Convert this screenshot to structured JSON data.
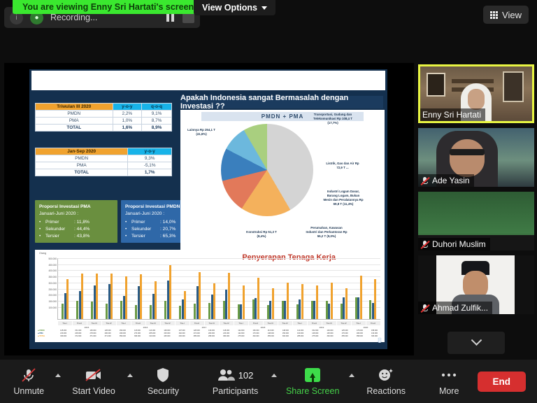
{
  "top": {
    "recording_label": "Recording...",
    "view_banner": "You are viewing Enny Sri Hartati's screen",
    "view_options": "View Options",
    "view_button": "View"
  },
  "slide": {
    "page_number": "8",
    "headline": "Apakah Indonesia sangat Bermasalah dengan Investasi ??",
    "table_q3": {
      "title": "Triwulan III 2020",
      "columns": [
        "y-o-y",
        "q-o-q"
      ],
      "rows": [
        {
          "label": "PMDN",
          "yoy": "2,2%",
          "qoq": "9,1%"
        },
        {
          "label": "PMA",
          "yoy": "1,0%",
          "qoq": "8,7%"
        },
        {
          "label": "TOTAL",
          "yoy": "1,6%",
          "qoq": "8,9%"
        }
      ]
    },
    "table_jansep": {
      "title": "Jan-Sep 2020",
      "columns": [
        "y-o-y"
      ],
      "rows": [
        {
          "label": "PMDN",
          "yoy": "9,3%"
        },
        {
          "label": "PMA",
          "yoy": "-5,1%"
        },
        {
          "label": "TOTAL",
          "yoy": "1,7%"
        }
      ]
    },
    "box_pma": {
      "title": "Proporsi Investasi PMA",
      "subtitle": "Januari-Juni 2020 :",
      "items": [
        {
          "name": "Primer",
          "value": ": 11,8%"
        },
        {
          "name": "Sekunder",
          "value": ": 44,4%"
        },
        {
          "name": "Tersier",
          "value": ": 43,8%"
        }
      ]
    },
    "box_pmdn": {
      "title": "Proporsi Investasi PMDN",
      "subtitle": "Januari-Juni 2020 :",
      "items": [
        {
          "name": "Primer",
          "value": ": 14,0%"
        },
        {
          "name": "Sekunder",
          "value": ": 20,7%"
        },
        {
          "name": "Tersier",
          "value": ": 65,3%"
        }
      ]
    }
  },
  "chart_data": [
    {
      "type": "pie",
      "title": "PMDN + PMA",
      "unit": "Rp Triliun",
      "labels": [
        "Lainnya",
        "Transportasi, Gudang dan Telekomunikasi",
        "Listrik, Gas dan Air",
        "Industri Logam Dasar, Barang Logam, Bukan Mesin dan Peralatannya",
        "Perumahan, Kawasan Industri dan Perkantoran",
        "Konstruksi"
      ],
      "values": [
        254.1,
        108.4,
        72.9,
        69.8,
        55.2,
        51.3
      ],
      "percents": [
        41.6,
        17.7,
        11.9,
        11.4,
        9.0,
        8.4
      ],
      "value_labels": [
        "Lainnya\nRp 254,1 T\n(41,6%)",
        "Transportasi,\nGudang dan\nTelekomunikasi\nRp 108,4 T\n(17,7%)",
        "Listrik, Gas\ndan Air\nRp 72,9 T ...",
        "Industri Logam\nDasar, Barang\nLogam, Bukan\nMesin dan\nPeralatannya\nRp 69,8 T\n(11,4%)",
        "Perumahan,\nKawasan Industri\ndan Perkantoran\nRp 55,2 T\n(9,0%)",
        "Konstruksi\nRp 51,3 T\n(8,4%)"
      ],
      "colors": [
        "#d4d4d4",
        "#f4b15c",
        "#e2795a",
        "#3a7fbd",
        "#6cb8dd",
        "#a9cf7f"
      ],
      "legend_position": "labels"
    },
    {
      "type": "bar",
      "title": "Penyerapan Tenaga Kerja",
      "ylabel": "Orang",
      "xlabel": "",
      "ylim": [
        0,
        500000
      ],
      "yticks": [
        "100.000",
        "150.000",
        "200.000",
        "250.000",
        "300.000",
        "350.000",
        "400.000",
        "450.000",
        "500.000"
      ],
      "grid": true,
      "categories": [
        "Trw-I",
        "Trw-II",
        "Trw-III",
        "Trw-IV",
        "Trw-I",
        "Trw-II",
        "Trw-III",
        "Trw-IV",
        "Trw-I",
        "Trw-II",
        "Trw-III",
        "Trw-IV",
        "Trw-I",
        "Trw-II",
        "Trw-III",
        "Trw-IV",
        "Trw-I",
        "Trw-II",
        "Trw-III",
        "Trw-IV",
        "Trw-I",
        "Trw-II"
      ],
      "year_groups": [
        "2015",
        "2016",
        "2017",
        "2018",
        "2019",
        "2020"
      ],
      "series": [
        {
          "name": "PMDN",
          "color": "#6a9a45",
          "values": [
            125000,
            151000,
            145000,
            128000,
            150000,
            115000,
            113000,
            148000,
            107000,
            128000,
            132000,
            148000,
            122000,
            160000,
            113000,
            148000,
            122000,
            152000,
            149000,
            125000,
            176000,
            158000
          ]
        },
        {
          "name": "PMA",
          "color": "#2b5c86",
          "values": [
            213000,
            228000,
            278000,
            290000,
            190000,
            270000,
            205000,
            315000,
            162000,
            272000,
            200000,
            243000,
            122000,
            170000,
            148000,
            150000,
            160000,
            148000,
            125000,
            176000,
            180000,
            132000
          ]
        },
        {
          "name": "TOTAL",
          "color": "#f0a22e",
          "values": [
            330000,
            372000,
            371000,
            371000,
            350000,
            366000,
            310000,
            445000,
            230000,
            385000,
            295000,
            380000,
            275000,
            340000,
            255000,
            300000,
            285000,
            275000,
            300000,
            255000,
            358000,
            330000
          ]
        }
      ]
    }
  ],
  "participants": [
    {
      "name": "Enny Sri Hartati",
      "muted": false,
      "active": true,
      "video": "room"
    },
    {
      "name": "Ade Yasin",
      "muted": true,
      "active": false,
      "video": "portrait"
    },
    {
      "name": "Duhori Muslim",
      "muted": true,
      "active": false,
      "video": "green"
    },
    {
      "name": "Ahmad Zulfik...",
      "muted": true,
      "active": false,
      "video": "man"
    }
  ],
  "toolbar": {
    "unmute": "Unmute",
    "start_video": "Start Video",
    "security": "Security",
    "participants": "Participants",
    "participants_count": "102",
    "share_screen": "Share Screen",
    "reactions": "Reactions",
    "more": "More",
    "end": "End"
  }
}
